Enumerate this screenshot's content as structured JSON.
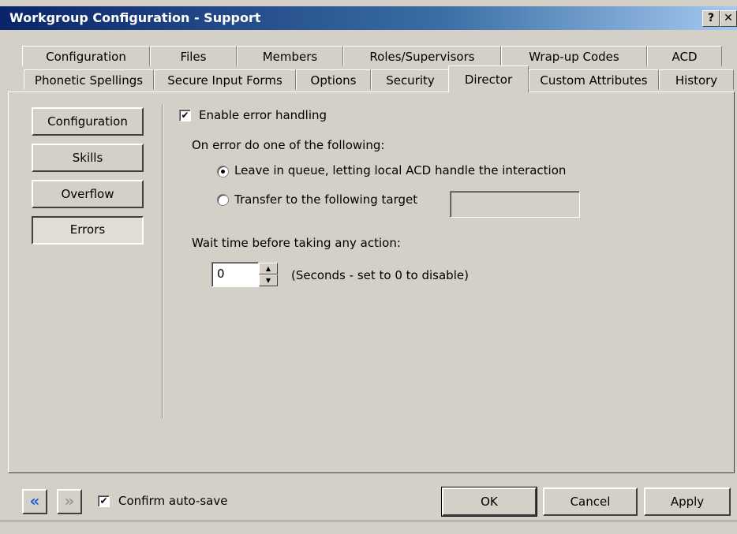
{
  "window": {
    "title": "Workgroup Configuration - Support",
    "help_label": "?",
    "close_label": "✕"
  },
  "tabs_row1": [
    "Configuration",
    "Files",
    "Members",
    "Roles/Supervisors",
    "Wrap-up Codes",
    "ACD"
  ],
  "tabs_row2": [
    "Phonetic Spellings",
    "Secure Input Forms",
    "Options",
    "Security",
    "Director",
    "Custom Attributes",
    "History"
  ],
  "active_tab": "Director",
  "side_nav": {
    "items": [
      "Configuration",
      "Skills",
      "Overflow",
      "Errors"
    ],
    "selected": "Errors"
  },
  "errors": {
    "enable_label": "Enable error handling",
    "enable_checked": true,
    "on_error_label": "On error do one of the following:",
    "option_queue_label": "Leave in queue, letting local ACD handle the interaction",
    "option_transfer_label": "Transfer to the following target",
    "selected_option": "queue",
    "transfer_target_value": "",
    "wait_label": "Wait time before taking any action:",
    "wait_value": "0",
    "wait_hint": "(Seconds - set to 0 to disable)"
  },
  "footer": {
    "back_icon": "«",
    "forward_icon": "»",
    "confirm_label": "Confirm auto-save",
    "confirm_checked": true,
    "ok_label": "OK",
    "cancel_label": "Cancel",
    "apply_label": "Apply"
  }
}
